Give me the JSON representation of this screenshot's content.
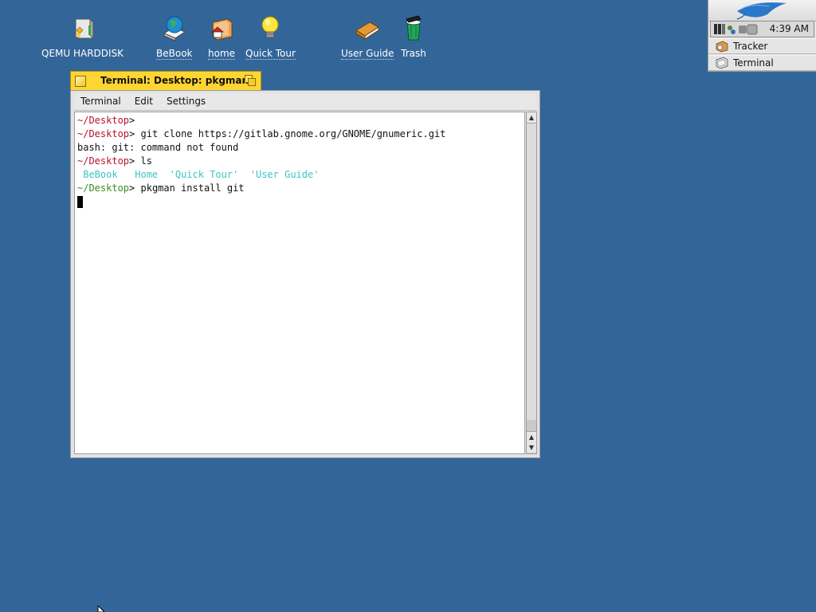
{
  "desktop": {
    "background_color": "#336698",
    "icons": [
      {
        "label": "QEMU HARDDISK",
        "icon": "harddisk-icon"
      },
      {
        "label": "BeBook",
        "icon": "globe-book-icon"
      },
      {
        "label": "home",
        "icon": "home-folder-icon"
      },
      {
        "label": "Quick Tour",
        "icon": "lightbulb-icon"
      },
      {
        "label": "User Guide",
        "icon": "book-icon"
      },
      {
        "label": "Trash",
        "icon": "trash-icon"
      }
    ]
  },
  "deskbar": {
    "clock": "4:39 AM",
    "items": [
      {
        "label": "Tracker",
        "icon": "tracker-icon"
      },
      {
        "label": "Terminal",
        "icon": "terminal-icon"
      }
    ]
  },
  "window": {
    "title": "Terminal: Desktop: pkgman",
    "tab_color": "#ffd531",
    "menu": [
      "Terminal",
      "Edit",
      "Settings"
    ]
  },
  "terminal": {
    "prompt_color": "#b8142c",
    "ls_color": "#3fc3c3",
    "lines": {
      "l1_prompt": "~/Desktop",
      "l1_sep": ">",
      "l2_prompt": "~/Desktop",
      "l2_sep": ">",
      "l2_cmd": " git clone https://gitlab.gnome.org/GNOME/gnumeric.git",
      "l3_out": "bash: git: command not found",
      "l4_prompt": "~/Desktop",
      "l4_sep": ">",
      "l4_cmd": " ls",
      "l5_items": [
        " BeBook",
        "   Home",
        "  'Quick Tour'",
        "  'User Guide'"
      ],
      "l6_prompt": "~/Desktop",
      "l6_sep": ">",
      "l6_cmd": " pkgman install git"
    }
  },
  "scrollbar": {
    "up": "▲",
    "down": "▼"
  }
}
